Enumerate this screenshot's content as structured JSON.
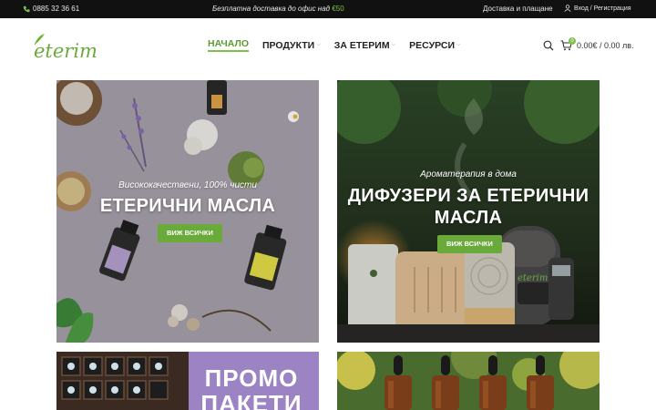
{
  "topbar": {
    "phone": "0885 32 36 61",
    "promo_text": "Безплатна доставка до офис над ",
    "promo_amount": "€50",
    "delivery_link": "Доставка и плащане",
    "account_link": "Вход / Регистрация"
  },
  "header": {
    "logo_text": "eterim",
    "nav": [
      {
        "label": "НАЧАЛО",
        "active": true
      },
      {
        "label": "ПРОДУКТИ",
        "has_dropdown": true
      },
      {
        "label": "ЗА ЕТЕРИМ",
        "has_dropdown": true
      },
      {
        "label": "РЕСУРСИ",
        "has_dropdown": true
      }
    ],
    "cart_count": "0",
    "cart_total": "0.00€ / 0.00 лв."
  },
  "banners": [
    {
      "subtitle": "Висококачествени, 100% чисти",
      "title": "ЕТЕРИЧНИ МАСЛА",
      "button": "ВИЖ ВСИЧКИ"
    },
    {
      "subtitle": "Ароматерапия в дома",
      "title_line1": "ДИФУЗЕРИ ЗА ЕТЕРИЧНИ",
      "title_line2": "МАСЛА",
      "button": "ВИЖ ВСИЧКИ",
      "brand_mark": "eterim"
    },
    {
      "title_line1": "ПРОМО",
      "title_line2": "ПАКЕТИ"
    },
    {}
  ],
  "colors": {
    "accent": "#7ec24b",
    "topbar_bg": "#111111",
    "button": "#6aaa3a"
  },
  "icons": [
    "phone-icon",
    "user-icon",
    "search-icon",
    "cart-icon",
    "chevron-down-icon"
  ]
}
